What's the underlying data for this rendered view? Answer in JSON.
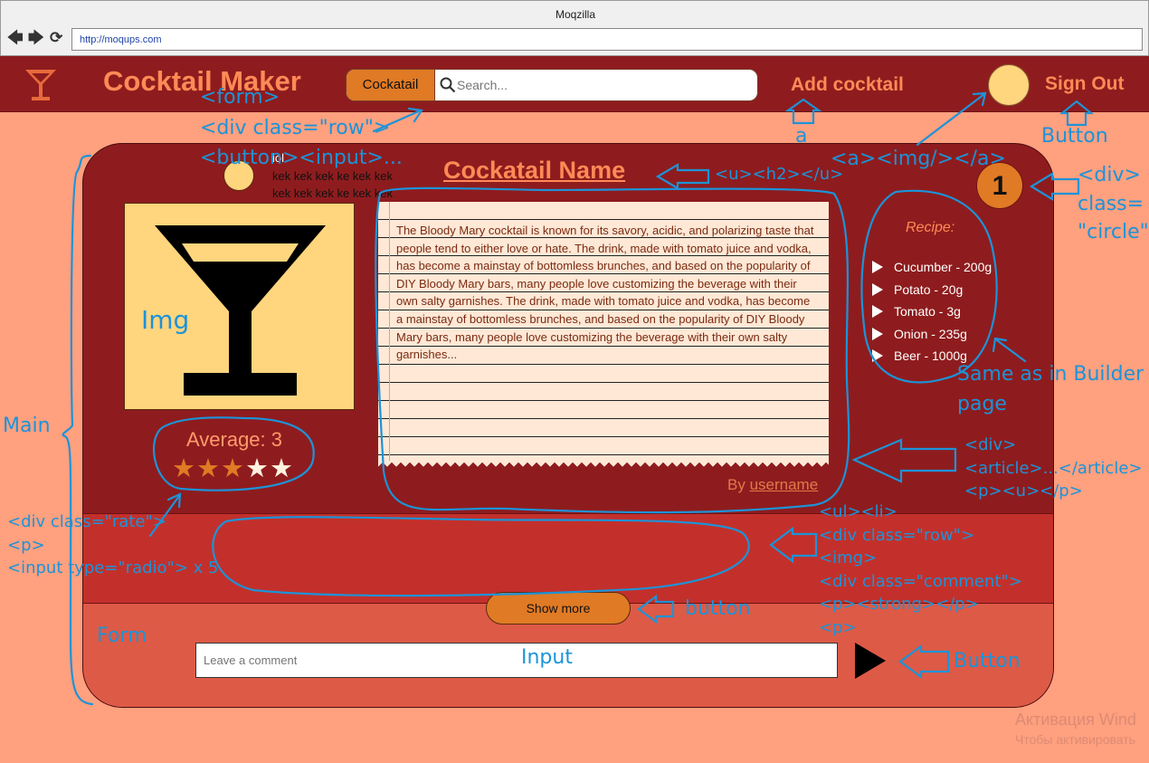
{
  "window": {
    "title": "Moqzilla",
    "url": "http://moqups.com"
  },
  "header": {
    "app_title": "Cocktail Maker",
    "category_button": "Cockatail",
    "search_placeholder": "Search...",
    "add_cocktail": "Add cocktail",
    "sign_out": "Sign Out"
  },
  "cocktail": {
    "name": "Cockatail Name",
    "rating_number": "1",
    "average_label": "Average: 3",
    "rating_value": 3,
    "rating_max": 5,
    "article": "The Bloody Mary cocktail is known for its savory, acidic, and polarizing taste that people tend to either love or hate. The drink, made with tomato juice and vodka, has become a mainstay of bottomless brunches, and based on the popularity of DIY Bloody Mary bars, many people love customizing the beverage with their own salty garnishes. The drink, made with tomato juice and vodka, has become a mainstay of bottomless brunches, and based on the popularity of DIY Bloody Mary bars, many people love customizing the beverage with their own salty garnishes...",
    "byline_prefix": "By",
    "byline_user": "username"
  },
  "recipe": {
    "title": "Recipe:",
    "items": [
      "Cucumber - 200g",
      "Potato - 20g",
      "Tomato - 3g",
      "Onion - 235g",
      "Beer - 1000g"
    ]
  },
  "comment": {
    "author": "lol",
    "line1": "kek kek kek ke kek kek",
    "line2": "kek kek kek ke kek kek"
  },
  "show_more": "Show more",
  "comment_form": {
    "placeholder": "Leave a comment"
  },
  "annotations": {
    "form": [
      "<form>",
      "<div class=\"row\">",
      "<button><input>..."
    ],
    "a": "a",
    "aimg": "<a><img/></a>",
    "button_signout": "Button",
    "h2": "<u><h2></u>",
    "circle": [
      "<div>",
      "class=",
      "\"circle\""
    ],
    "img": "Img",
    "main": "Main",
    "builder": [
      "Same as in Builder",
      "page"
    ],
    "article": [
      "<div>",
      "<article>...</article>",
      "<p><u></p>"
    ],
    "rate": [
      "<div class=\"rate\">",
      "<p>",
      "<input type=\"radio\"> x 5"
    ],
    "comment": [
      "<ul><li>",
      "<div class=\"row\">",
      "<img>",
      "<div class=\"comment\">",
      "<p><strong></p>",
      "<p>"
    ],
    "button_show": "button",
    "form_label": "Form",
    "input_label": "Input",
    "button_send": "Button"
  },
  "watermark": {
    "line1": "Активация Wind",
    "line2": "Чтобы активировать"
  },
  "colors": {
    "header_bg": "#8e1c1e",
    "accent": "#ff8a56",
    "button": "#e07a24",
    "annotation": "#1d93d8",
    "page_bg": "#ffa07f"
  },
  "icons": [
    "back-arrow-icon",
    "forward-arrow-icon",
    "reload-icon",
    "cocktail-glass-icon",
    "search-icon",
    "play-triangle-icon",
    "send-icon"
  ]
}
